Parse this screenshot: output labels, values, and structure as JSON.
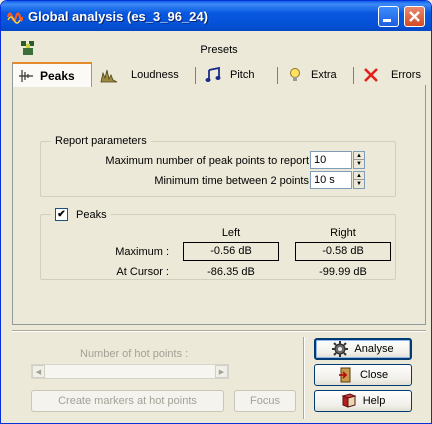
{
  "window": {
    "title": "Global analysis (es_3_96_24)"
  },
  "presets": {
    "label": "Presets"
  },
  "tabs": [
    {
      "label": "Peaks",
      "icon": "waveform-icon",
      "active": true
    },
    {
      "label": "Loudness",
      "icon": "loudness-icon",
      "active": false
    },
    {
      "label": "Pitch",
      "icon": "music-note-icon",
      "active": false
    },
    {
      "label": "Extra",
      "icon": "lightbulb-icon",
      "active": false
    },
    {
      "label": "Errors",
      "icon": "red-x-icon",
      "active": false
    }
  ],
  "report_parameters": {
    "legend": "Report parameters",
    "max_peaks_label": "Maximum number of peak points to report",
    "max_peaks_value": "10",
    "min_time_label": "Minimum time between 2 points",
    "min_time_value": "10 s"
  },
  "peaks": {
    "legend": "Peaks",
    "checked": true,
    "check_mark": "✔",
    "col_left": "Left",
    "col_right": "Right",
    "maximum_label": "Maximum :",
    "maximum_left": "-0.56 dB",
    "maximum_right": "-0.58 dB",
    "cursor_label": "At Cursor :",
    "cursor_left": "-86.35 dB",
    "cursor_right": "-99.99 dB"
  },
  "hot_points": {
    "label": "Number of hot points :",
    "create_markers": "Create markers at hot points",
    "focus": "Focus"
  },
  "buttons": {
    "analyse": "Analyse",
    "close": "Close",
    "help": "Help"
  },
  "colors": {
    "titlebar": "#0551d6",
    "active_tab_accent": "#e68b2c",
    "face": "#ece9d8"
  }
}
